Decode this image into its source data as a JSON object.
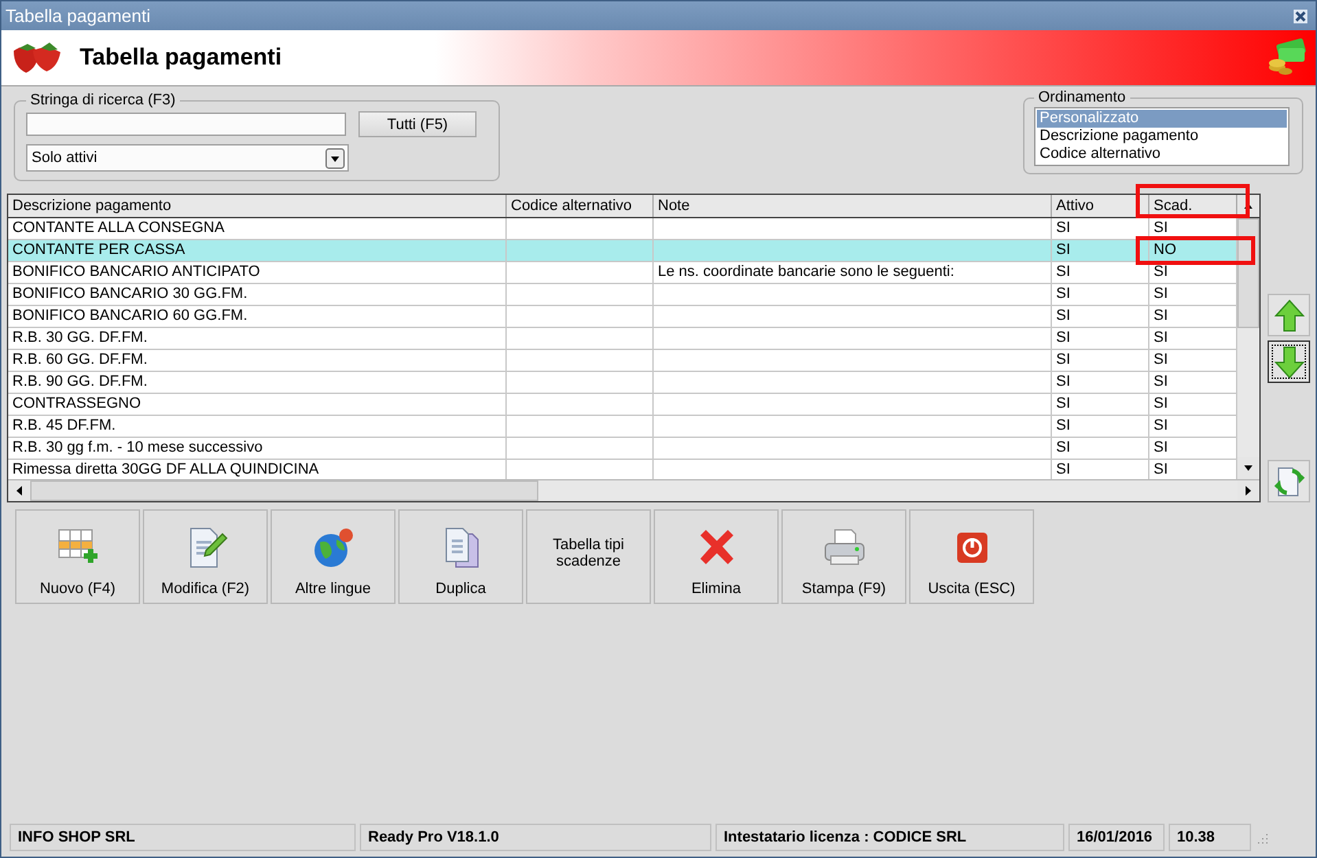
{
  "window": {
    "title": "Tabella pagamenti"
  },
  "header": {
    "title": "Tabella pagamenti"
  },
  "search": {
    "legend": "Stringa di ricerca (F3)",
    "button": "Tutti (F5)",
    "filter": "Solo attivi"
  },
  "ordering": {
    "legend": "Ordinamento",
    "options": [
      {
        "label": "Personalizzato",
        "selected": true
      },
      {
        "label": "Descrizione pagamento",
        "selected": false
      },
      {
        "label": "Codice alternativo",
        "selected": false
      }
    ]
  },
  "table": {
    "columns": [
      {
        "label": "Descrizione pagamento",
        "flagged": false
      },
      {
        "label": "Codice alternativo",
        "flagged": false
      },
      {
        "label": "Note",
        "flagged": false
      },
      {
        "label": "Attivo",
        "flagged": false
      },
      {
        "label": "Scad.",
        "flagged": true
      }
    ],
    "rows": [
      {
        "cells": [
          "CONTANTE ALLA CONSEGNA",
          "",
          "",
          "SI",
          "SI"
        ],
        "selected": false,
        "flagged": false
      },
      {
        "cells": [
          "CONTANTE PER CASSA",
          "",
          "",
          "SI",
          "NO"
        ],
        "selected": true,
        "flagged": true
      },
      {
        "cells": [
          "BONIFICO BANCARIO ANTICIPATO",
          "",
          "Le ns. coordinate bancarie sono le seguenti:",
          "SI",
          "SI"
        ],
        "selected": false,
        "flagged": false
      },
      {
        "cells": [
          "BONIFICO BANCARIO 30 GG.FM.",
          "",
          "",
          "SI",
          "SI"
        ],
        "selected": false,
        "flagged": false
      },
      {
        "cells": [
          "BONIFICO BANCARIO 60 GG.FM.",
          "",
          "",
          "SI",
          "SI"
        ],
        "selected": false,
        "flagged": false
      },
      {
        "cells": [
          "R.B. 30 GG. DF.FM.",
          "",
          "",
          "SI",
          "SI"
        ],
        "selected": false,
        "flagged": false
      },
      {
        "cells": [
          "R.B. 60 GG. DF.FM.",
          "",
          "",
          "SI",
          "SI"
        ],
        "selected": false,
        "flagged": false
      },
      {
        "cells": [
          "R.B. 90 GG. DF.FM.",
          "",
          "",
          "SI",
          "SI"
        ],
        "selected": false,
        "flagged": false
      },
      {
        "cells": [
          "CONTRASSEGNO",
          "",
          "",
          "SI",
          "SI"
        ],
        "selected": false,
        "flagged": false
      },
      {
        "cells": [
          "R.B. 45 DF.FM.",
          "",
          "",
          "SI",
          "SI"
        ],
        "selected": false,
        "flagged": false
      },
      {
        "cells": [
          "R.B. 30 gg f.m. - 10 mese successivo",
          "",
          "",
          "SI",
          "SI"
        ],
        "selected": false,
        "flagged": false
      },
      {
        "cells": [
          "Rimessa diretta 30GG DF ALLA QUINDICINA",
          "",
          "",
          "SI",
          "SI"
        ],
        "selected": false,
        "flagged": false
      }
    ]
  },
  "toolbar": [
    {
      "label": "Nuovo (F4)",
      "kind": "new"
    },
    {
      "label": "Modifica (F2)",
      "kind": "edit"
    },
    {
      "label": "Altre lingue",
      "kind": "globe"
    },
    {
      "label": "Duplica",
      "kind": "copy"
    },
    {
      "label": "Tabella tipi scadenze",
      "kind": "text"
    },
    {
      "label": "Elimina",
      "kind": "delete"
    },
    {
      "label": "Stampa (F9)",
      "kind": "print"
    },
    {
      "label": "Uscita (ESC)",
      "kind": "exit"
    }
  ],
  "status_bar": [
    "INFO SHOP SRL",
    "Ready Pro V18.1.0",
    "Intestatario licenza : CODICE SRL",
    "16/01/2016",
    "10.38"
  ]
}
